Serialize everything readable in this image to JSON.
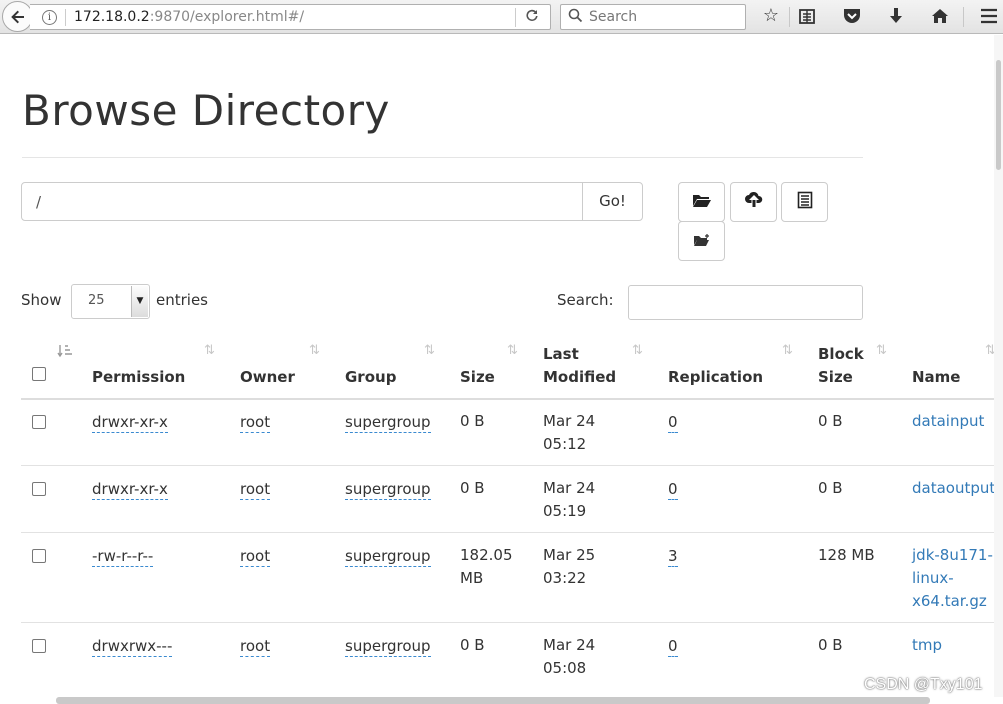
{
  "browser": {
    "url_host": "172.18.0.2",
    "url_rest": ":9870/explorer.html#/",
    "search_placeholder": "Search"
  },
  "page": {
    "title": "Browse Directory",
    "path_value": "/",
    "go_label": "Go!"
  },
  "controls": {
    "show_label": "Show",
    "entries_value": "25",
    "entries_label": "entries",
    "search_label": "Search:"
  },
  "table": {
    "columns": [
      {
        "line1": "",
        "line2": "Permission"
      },
      {
        "line1": "",
        "line2": "Owner"
      },
      {
        "line1": "",
        "line2": "Group"
      },
      {
        "line1": "",
        "line2": "Size"
      },
      {
        "line1": "Last",
        "line2": "Modified"
      },
      {
        "line1": "",
        "line2": "Replication"
      },
      {
        "line1": "Block",
        "line2": "Size"
      },
      {
        "line1": "",
        "line2": "Name"
      }
    ],
    "rows": [
      {
        "permission": "drwxr-xr-x",
        "owner": "root",
        "group": "supergroup",
        "size1": "0 B",
        "size2": "",
        "mod1": "Mar 24",
        "mod2": "05:12",
        "replication": "0",
        "block": "0 B",
        "name1": "datainput",
        "name2": "",
        "name3": ""
      },
      {
        "permission": "drwxr-xr-x",
        "owner": "root",
        "group": "supergroup",
        "size1": "0 B",
        "size2": "",
        "mod1": "Mar 24",
        "mod2": "05:19",
        "replication": "0",
        "block": "0 B",
        "name1": "dataoutput",
        "name2": "",
        "name3": ""
      },
      {
        "permission": "-rw-r--r--",
        "owner": "root",
        "group": "supergroup",
        "size1": "182.05",
        "size2": "MB",
        "mod1": "Mar 25",
        "mod2": "03:22",
        "replication": "3",
        "block": "128 MB",
        "name1": "jdk-8u171-",
        "name2": "linux-",
        "name3": "x64.tar.gz"
      },
      {
        "permission": "drwxrwx---",
        "owner": "root",
        "group": "supergroup",
        "size1": "0 B",
        "size2": "",
        "mod1": "Mar 24",
        "mod2": "05:08",
        "replication": "0",
        "block": "0 B",
        "name1": "tmp",
        "name2": "",
        "name3": ""
      }
    ]
  },
  "watermark": "CSDN @Txy101",
  "icons": {
    "back": "back-arrow-icon",
    "info": "info-icon",
    "reload": "reload-icon",
    "search": "search-icon",
    "bookmark": "star-icon",
    "reader": "reading-list-icon",
    "pocket": "pocket-icon",
    "download": "download-icon",
    "home": "home-icon",
    "menu": "hamburger-menu-icon",
    "open": "folder-open-icon",
    "upload": "cloud-upload-icon",
    "list": "list-icon",
    "mkdir": "new-folder-icon"
  },
  "colors": {
    "link": "#337ab7",
    "border": "#cccccc",
    "text": "#333333"
  }
}
